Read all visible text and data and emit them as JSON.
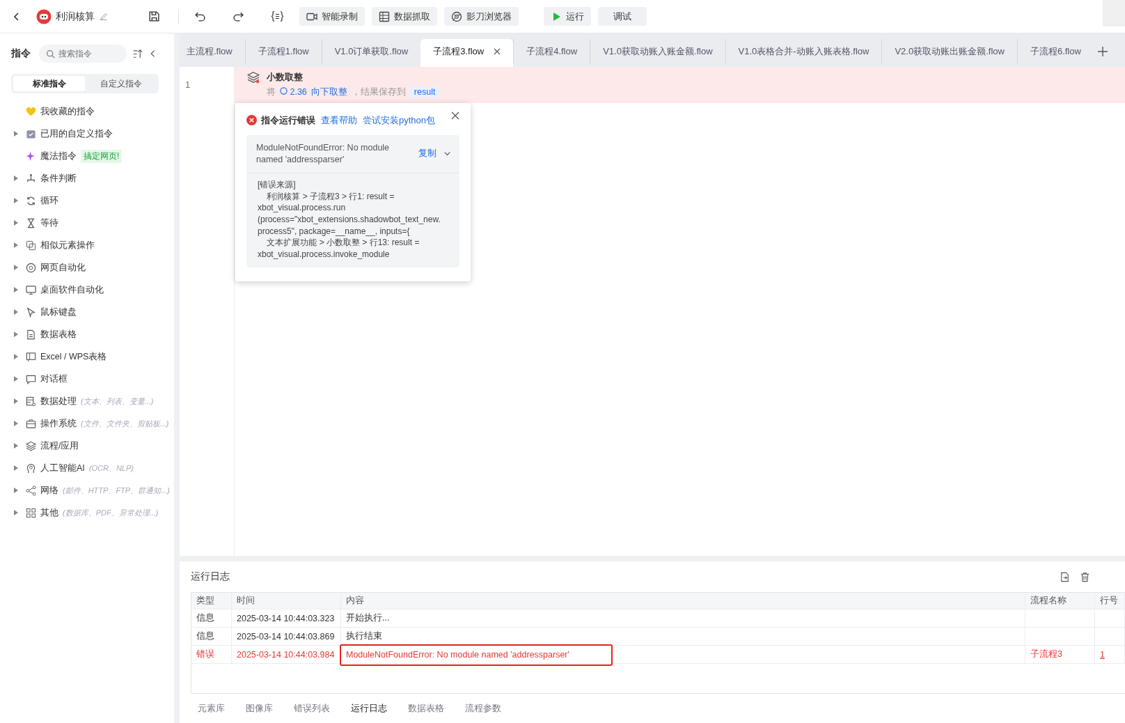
{
  "toolbar": {
    "title": "利润核算",
    "buttons": [
      {
        "label": "智能录制",
        "kind": "record"
      },
      {
        "label": "数据抓取",
        "kind": "table"
      },
      {
        "label": "影刀浏览器",
        "kind": "browser"
      },
      {
        "label": "运行",
        "kind": "run"
      },
      {
        "label": "调试",
        "kind": "plain"
      }
    ]
  },
  "sidebar": {
    "title": "指令",
    "search": {
      "placeholder": "搜索指令"
    },
    "segments": [
      {
        "label": "标准指令",
        "selected": true
      },
      {
        "label": "自定义指令",
        "selected": false
      }
    ],
    "items": [
      {
        "label": "我收藏的指令",
        "expandable": false
      },
      {
        "label": "已用的自定义指令",
        "expandable": true
      },
      {
        "label": "魔法指令",
        "expandable": false,
        "badge": "搞定网页!"
      },
      {
        "label": "条件判断",
        "expandable": true
      },
      {
        "label": "循环",
        "expandable": true
      },
      {
        "label": "等待",
        "expandable": true
      },
      {
        "label": "相似元素操作",
        "expandable": true
      },
      {
        "label": "网页自动化",
        "expandable": true
      },
      {
        "label": "桌面软件自动化",
        "expandable": true
      },
      {
        "label": "鼠标键盘",
        "expandable": true
      },
      {
        "label": "数据表格",
        "expandable": true
      },
      {
        "label": "Excel / WPS表格",
        "expandable": true
      },
      {
        "label": "对话框",
        "expandable": true
      },
      {
        "label": "数据处理",
        "expandable": true,
        "hint": "(文本、列表、变量...)"
      },
      {
        "label": "操作系统",
        "expandable": true,
        "hint": "(文件、文件夹、剪贴板...)"
      },
      {
        "label": "流程/应用",
        "expandable": true
      },
      {
        "label": "人工智能AI",
        "expandable": true,
        "hint": "(OCR、NLP)"
      },
      {
        "label": "网络",
        "expandable": true,
        "hint": "(邮件、HTTP、FTP、群通知...)"
      },
      {
        "label": "其他",
        "expandable": true,
        "hint": "(数据库、PDF、异常处理...)"
      }
    ]
  },
  "tabs": [
    {
      "label": "主流程.flow",
      "selected": false
    },
    {
      "label": "子流程1.flow",
      "selected": false
    },
    {
      "label": "V1.0订单获取.flow",
      "selected": false
    },
    {
      "label": "子流程3.flow",
      "selected": true
    },
    {
      "label": "子流程4.flow",
      "selected": false
    },
    {
      "label": "V1.0获取动账入账金额.flow",
      "selected": false
    },
    {
      "label": "V1.0表格合并-动账入账表格.flow",
      "selected": false
    },
    {
      "label": "V2.0获取动账出账金额.flow",
      "selected": false
    },
    {
      "label": "子流程6.flow",
      "selected": false
    }
  ],
  "editor": {
    "lines": [
      {
        "number": "1",
        "title": "小数取整",
        "parts": [
          "将",
          "2.36",
          "向下取整",
          "，结果保存到",
          "result"
        ],
        "error": true
      }
    ]
  },
  "error_popup": {
    "title": "指令运行错误",
    "links": [
      "查看帮助",
      "尝试安装python包"
    ],
    "message": "ModuleNotFoundError: No module named 'addressparser'",
    "copy": "复制",
    "details": "[错误来源]\n    利润核算 > 子流程3 > 行1: result =\nxbot_visual.process.run\n(process=\"xbot_extensions.shadowbot_text_new.\nprocess5\", package=__name__, inputs={\n    文本扩展功能 > 小数取整 > 行13: result =\nxbot_visual.process.invoke_module"
  },
  "log": {
    "title": "运行日志",
    "columns": [
      "类型",
      "时间",
      "内容",
      "流程名称",
      "行号"
    ],
    "rows": [
      {
        "type": "信息",
        "time": "2025-03-14 10:44:03.323",
        "content": "开始执行...",
        "flow": "",
        "line": "",
        "error": false,
        "annotated": false
      },
      {
        "type": "信息",
        "time": "2025-03-14 10:44:03.869",
        "content": "执行结束",
        "flow": "",
        "line": "",
        "error": false,
        "annotated": false
      },
      {
        "type": "错误",
        "time": "2025-03-14 10:44:03.984",
        "content": "ModuleNotFoundError: No module named 'addressparser'",
        "flow": "子流程3",
        "line": "1",
        "error": true,
        "annotated": true
      }
    ]
  },
  "bottom_tabs": [
    {
      "label": "元素库",
      "selected": false
    },
    {
      "label": "图像库",
      "selected": false
    },
    {
      "label": "错误列表",
      "selected": false
    },
    {
      "label": "运行日志",
      "selected": true
    },
    {
      "label": "数据表格",
      "selected": false
    },
    {
      "label": "流程参数",
      "selected": false
    }
  ]
}
